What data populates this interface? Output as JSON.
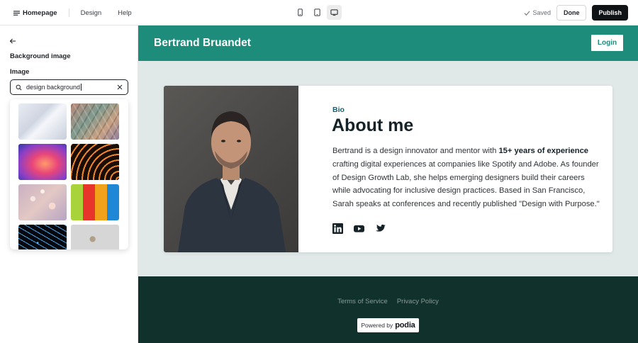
{
  "topbar": {
    "homepage_label": "Homepage",
    "design_label": "Design",
    "help_label": "Help",
    "saved_label": "Saved",
    "done_label": "Done",
    "publish_label": "Publish"
  },
  "sidebar": {
    "section_title": "Background image",
    "image_label": "Image",
    "search_value": "design background",
    "results": [
      {
        "name": "white-waves"
      },
      {
        "name": "colorful-scales"
      },
      {
        "name": "neon-corridor"
      },
      {
        "name": "orange-light-lines"
      },
      {
        "name": "pink-bokeh"
      },
      {
        "name": "paint-rollers"
      },
      {
        "name": "blue-network"
      },
      {
        "name": "coffee-cup-gray"
      }
    ]
  },
  "site": {
    "name": "Bertrand Bruandet",
    "login_label": "Login",
    "bio_label": "Bio",
    "bio_title": "About me",
    "bio_text_before": "Bertrand is a design innovator and mentor with ",
    "bio_text_bold": "15+ years of experience",
    "bio_text_after": " crafting digital experiences at companies like Spotify and Adobe. As founder of Design Growth Lab, she helps emerging designers build their careers while advocating for inclusive design practices. Based in San Francisco, Sarah speaks at conferences and recently published \"Design with Purpose.\"",
    "footer_links": [
      "Terms of Service",
      "Privacy Policy"
    ],
    "powered_by_label": "Powered by",
    "powered_by_brand": "podia"
  },
  "colors": {
    "header_bg": "#1e8c7b",
    "canvas_bg": "#e1e8e8",
    "footer_bg": "#11312c",
    "publish_bg": "#0f1315"
  }
}
